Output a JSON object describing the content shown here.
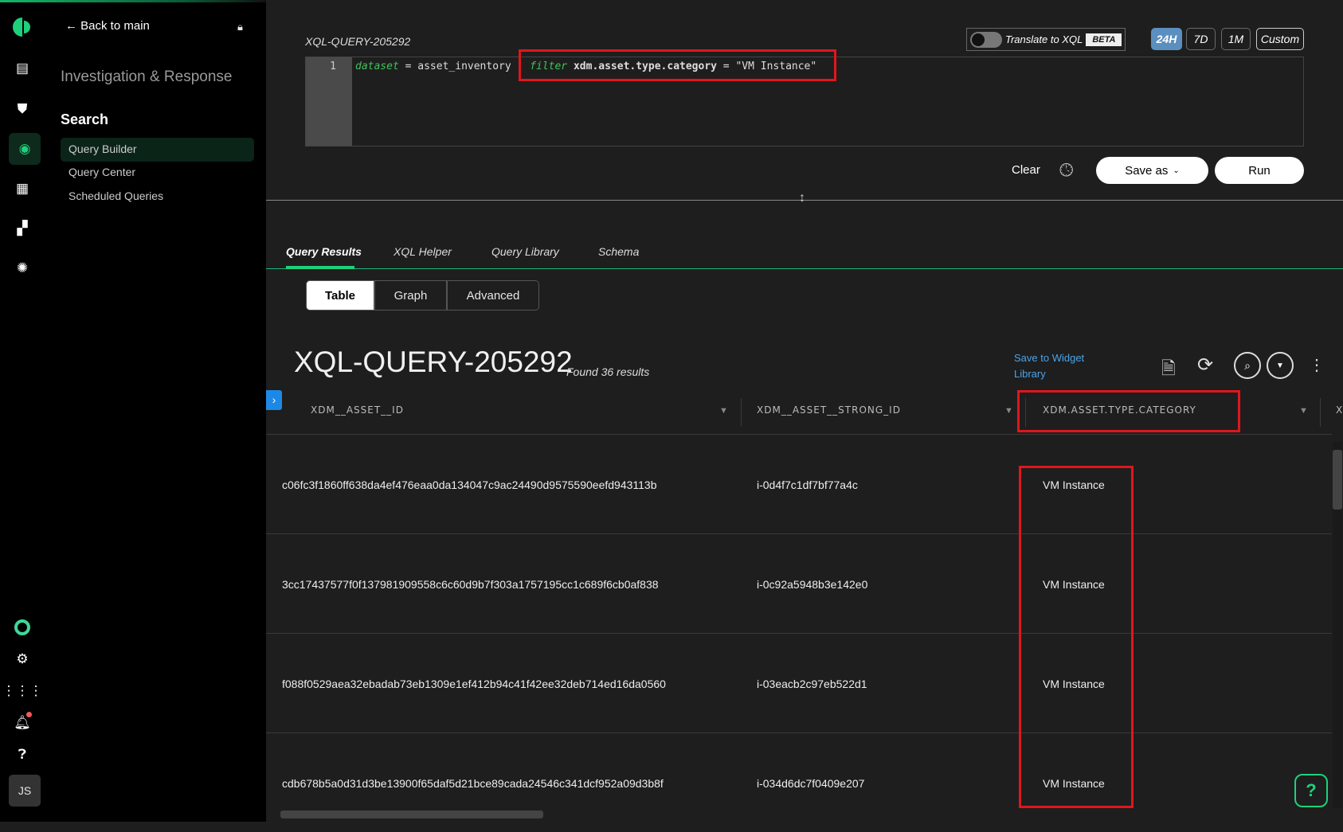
{
  "nav": {
    "back": "Back to main",
    "section": "Investigation & Response",
    "group": "Search",
    "items": [
      "Query Builder",
      "Query Center",
      "Scheduled Queries"
    ]
  },
  "avatar": "JS",
  "editor": {
    "query_name": "XQL-QUERY-205292",
    "line_number": "1",
    "code": {
      "kw1": "dataset",
      "op1": " = ",
      "src": "asset_inventory",
      "pipe": " | ",
      "kw2": "filter",
      "field": " xdm.asset.type.category",
      "op2": " = ",
      "value": "\"VM Instance\""
    }
  },
  "translate": {
    "label": "Translate to XQL",
    "badge": "BETA"
  },
  "time_ranges": [
    "24H",
    "7D",
    "1M",
    "Custom"
  ],
  "actions": {
    "clear": "Clear",
    "save_as": "Save as",
    "run": "Run"
  },
  "tabs": [
    "Query Results",
    "XQL Helper",
    "Query Library",
    "Schema"
  ],
  "views": [
    "Table",
    "Graph",
    "Advanced"
  ],
  "results": {
    "title": "XQL-QUERY-205292",
    "count": "Found 36 results",
    "save_widget": "Save to Widget Library"
  },
  "table": {
    "columns": [
      "XDM__ASSET__ID",
      "XDM__ASSET__STRONG_ID",
      "XDM.ASSET.TYPE.CATEGORY",
      "X"
    ],
    "rows": [
      [
        "c06fc3f1860ff638da4ef476eaa0da134047c9ac24490d9575590eefd943113b",
        "i-0d4f7c1df7bf77a4c",
        "VM Instance"
      ],
      [
        "3cc17437577f0f137981909558c6c60d9b7f303a1757195cc1c689f6cb0af838",
        "i-0c92a5948b3e142e0",
        "VM Instance"
      ],
      [
        "f088f0529aea32ebadab73eb1309e1ef412b94c41f42ee32deb714ed16da0560",
        "i-03eacb2c97eb522d1",
        "VM Instance"
      ],
      [
        "cdb678b5a0d31d3be13900f65daf5d21bce89cada24546c341dcf952a09d3b8f",
        "i-034d6dc7f0409e207",
        "VM Instance"
      ]
    ]
  },
  "help": "?",
  "colors": {
    "accent": "#1fd07a",
    "active_time": "#5b8fc0",
    "link": "#4aa3e8",
    "highlight": "#e0161c"
  }
}
